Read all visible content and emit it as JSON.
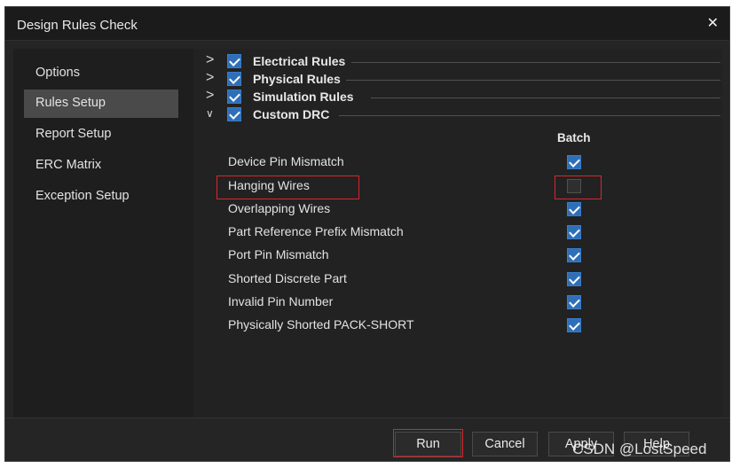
{
  "window": {
    "title": "Design Rules Check",
    "close_glyph": "✕"
  },
  "sidebar": {
    "items": [
      {
        "label": "Options",
        "active": false
      },
      {
        "label": "Rules Setup",
        "active": true
      },
      {
        "label": "Report Setup",
        "active": false
      },
      {
        "label": "ERC Matrix",
        "active": false
      },
      {
        "label": "Exception Setup",
        "active": false
      }
    ]
  },
  "sections": [
    {
      "label": "Electrical Rules",
      "checked": true,
      "expanded": false
    },
    {
      "label": "Physical Rules",
      "checked": true,
      "expanded": false
    },
    {
      "label": "Simulation Rules",
      "checked": true,
      "expanded": false
    },
    {
      "label": "Custom DRC",
      "checked": true,
      "expanded": true
    }
  ],
  "rules_table": {
    "column_header": "Batch",
    "rows": [
      {
        "label": "Device Pin Mismatch",
        "checked": true
      },
      {
        "label": "Hanging Wires",
        "checked": false
      },
      {
        "label": "Overlapping Wires",
        "checked": true
      },
      {
        "label": "Part Reference Prefix Mismatch",
        "checked": true
      },
      {
        "label": "Port Pin Mismatch",
        "checked": true
      },
      {
        "label": "Shorted Discrete Part",
        "checked": true
      },
      {
        "label": "Invalid Pin Number",
        "checked": true
      },
      {
        "label": "Physically Shorted PACK-SHORT",
        "checked": true
      }
    ]
  },
  "buttons": {
    "run": "Run",
    "cancel": "Cancel",
    "apply": "Apply",
    "help": "Help"
  },
  "watermark": "CSDN @LostSpeed",
  "colors": {
    "accent": "#2f6fb8",
    "highlight": "#d8262d",
    "background": "#252525"
  }
}
